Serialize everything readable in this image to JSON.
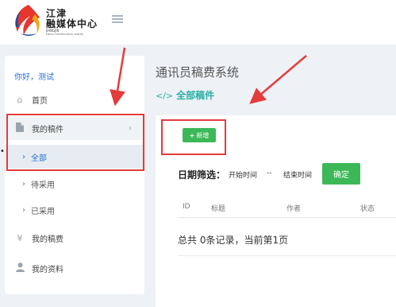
{
  "header": {
    "logo_line1": "江津",
    "logo_line2": "融媒体中心",
    "logo_en_line1": "JIANGJIN",
    "logo_en_line2": "MEDIA CONVERGENCE CENTER"
  },
  "sidebar": {
    "greeting": "你好，测试",
    "home_label": "首页",
    "my_manuscripts_label": "我的稿件",
    "sub_items": [
      {
        "label": "全部"
      },
      {
        "label": "待采用"
      },
      {
        "label": "已采用"
      }
    ],
    "fees_label": "我的稿费",
    "profile_label": "我的资料"
  },
  "main": {
    "page_title": "通讯员稿费系统",
    "section_code": "</>",
    "section_title": "全部稿件",
    "add_button": "新增",
    "filter_label": "日期筛选：",
    "start_placeholder": "开始时间",
    "range_separator": "--",
    "end_placeholder": "结束时间",
    "confirm_button": "确定",
    "table_headers": [
      "ID",
      "标题",
      "作者",
      "状态"
    ],
    "summary_text": "总共 0条记录，当前第1页"
  },
  "colors": {
    "accent_blue": "#2a6fd6",
    "accent_teal": "#29b0a8",
    "button_green": "#3cb858",
    "annotation_red": "#e43b3b"
  },
  "icons": {
    "home": "home-icon",
    "manuscripts": "document-icon",
    "fees": "yen-icon",
    "profile": "user-icon",
    "menu": "hamburger-icon"
  }
}
